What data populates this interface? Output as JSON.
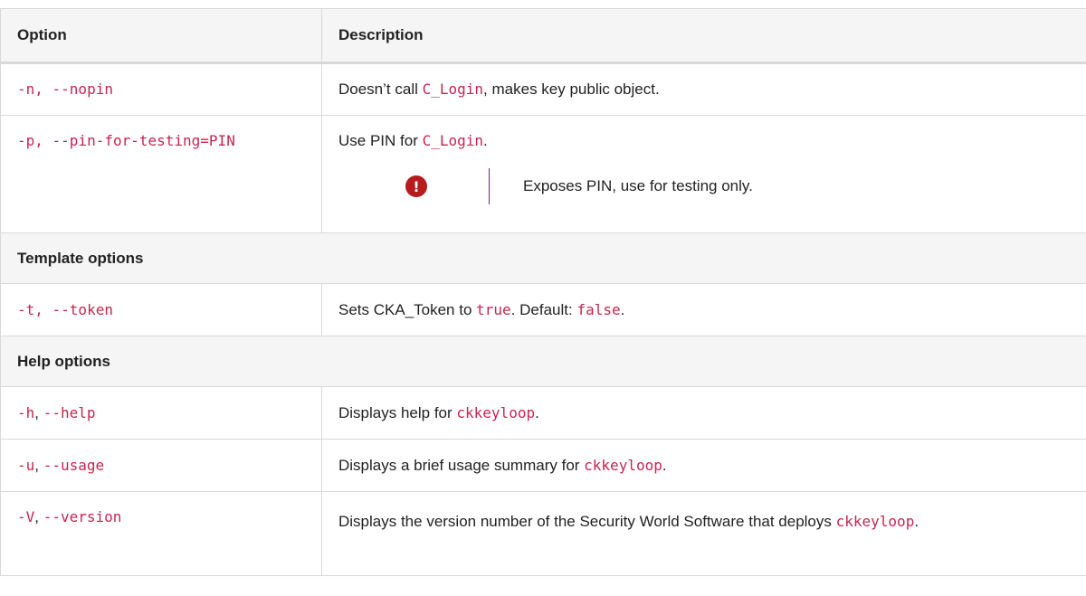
{
  "header": {
    "option": "Option",
    "description": "Description"
  },
  "rows": [
    {
      "option": "-n, --nopin",
      "desc_pre": "Doesn’t call ",
      "desc_code": "C_Login",
      "desc_post": ", makes key public object."
    },
    {
      "option": "-p, --pin-for-testing=PIN",
      "desc_pre": "Use PIN for ",
      "desc_code": "C_Login",
      "desc_post": ".",
      "warning": "Exposes PIN, use for testing only."
    }
  ],
  "sections": {
    "template": "Template options",
    "help": "Help options"
  },
  "template_rows": [
    {
      "option": "-t, --token",
      "desc_pre": "Sets CKA_Token to ",
      "code1": "true",
      "desc_mid": ". Default: ",
      "code2": "false",
      "desc_post": "."
    }
  ],
  "help_rows": [
    {
      "opt_short": "-h",
      "sep": ", ",
      "opt_long": "--help",
      "desc_pre": "Displays help for ",
      "desc_code": "ckkeyloop",
      "desc_post": "."
    },
    {
      "opt_short": "-u",
      "sep": ", ",
      "opt_long": "--usage",
      "desc_pre": "Displays a brief usage summary for ",
      "desc_code": "ckkeyloop",
      "desc_post": "."
    },
    {
      "opt_short": "-V",
      "sep": ", ",
      "opt_long": "--version",
      "desc_pre": "Displays the version number of the Security World Software that deploys ",
      "desc_code": "ckkeyloop",
      "desc_post": "."
    }
  ],
  "icons": {
    "warning": "exclamation-circle-icon",
    "warning_glyph": "!"
  },
  "colors": {
    "code": "#c7254e",
    "warning": "#b71c1c",
    "section_bg": "#f5f5f5"
  }
}
